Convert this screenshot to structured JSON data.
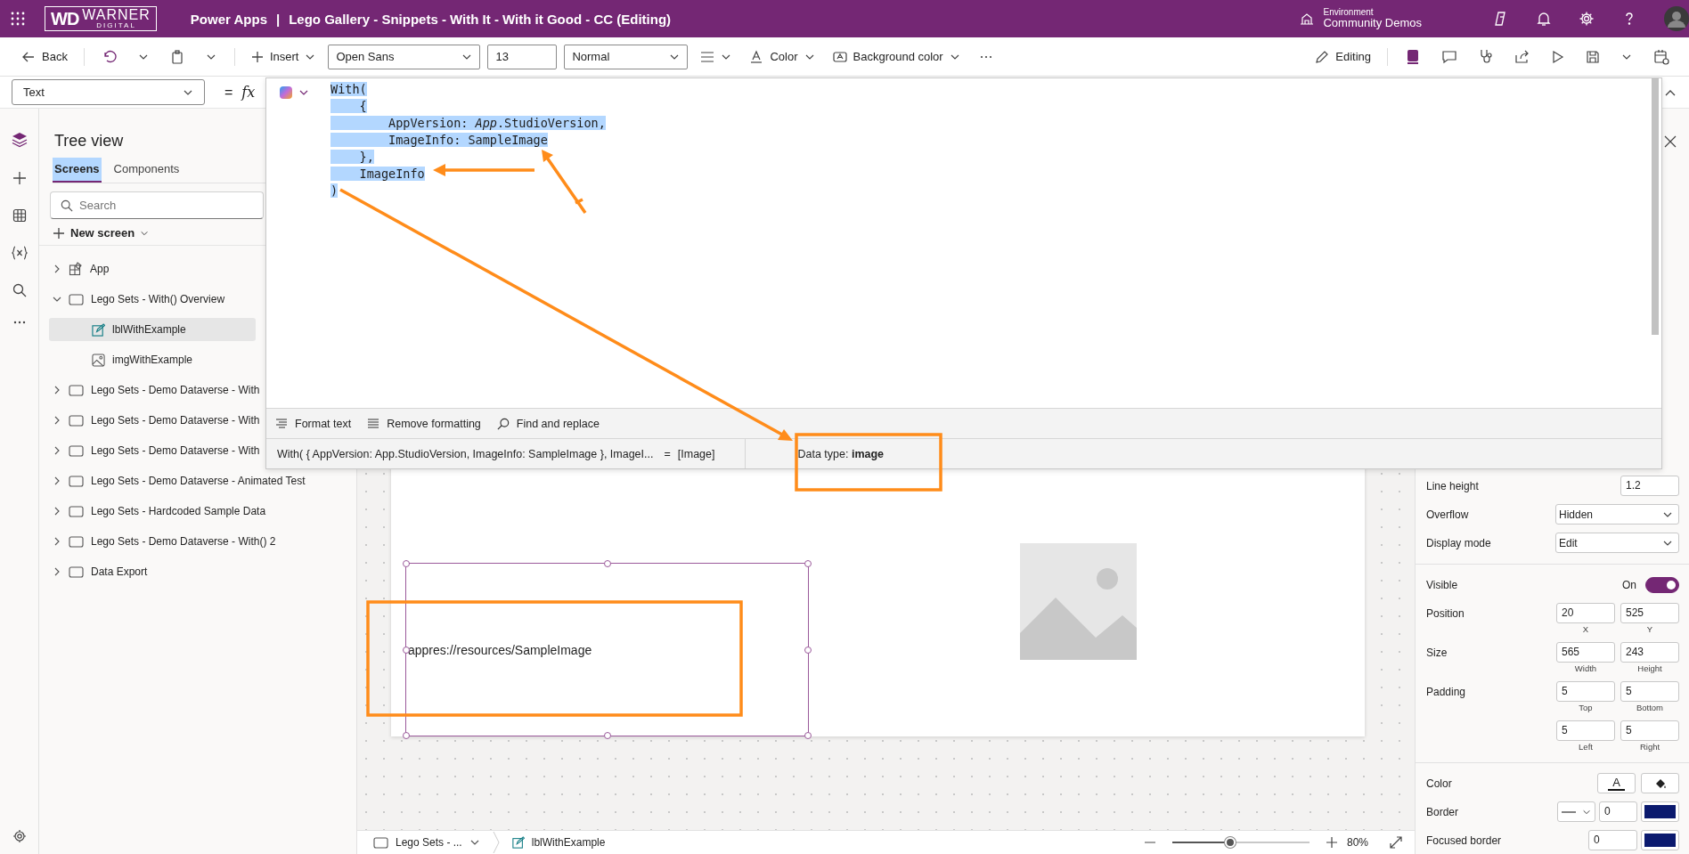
{
  "top_bar": {
    "logo": {
      "mark": "WD",
      "name": "WARNER",
      "sub": "DIGITAL"
    },
    "app_name": "Power Apps",
    "separator": "|",
    "title": "Lego Gallery - Snippets - With It - With it Good - CC (Editing)",
    "environment_label": "Environment",
    "environment": "Community Demos"
  },
  "toolbar": {
    "back": "Back",
    "insert": "Insert",
    "font": "Open Sans",
    "font_size": "13",
    "font_weight": "Normal",
    "color_label": "Color",
    "background_color": "Background color",
    "editing": "Editing"
  },
  "formula_bar": {
    "property": "Text",
    "equals": "=",
    "fx": "fx"
  },
  "formula_editor": {
    "code_lines": [
      "With(",
      "    {",
      "        AppVersion: *App*.StudioVersion,",
      "        ImageInfo: SampleImage",
      "    },",
      "    ImageInfo",
      ")"
    ],
    "tools": [
      {
        "kind": "format",
        "label": "Format text"
      },
      {
        "kind": "remove",
        "label": "Remove formatting"
      },
      {
        "kind": "find",
        "label": "Find and replace"
      }
    ],
    "result_expression": "With( { AppVersion: App.StudioVersion, ImageInfo: SampleImage }, ImageI...",
    "result_equals": "=",
    "result_value": "[Image]",
    "data_type": "Data type: **image**"
  },
  "tree": {
    "title": "Tree view",
    "tabs": [
      {
        "label": "Screens",
        "selected": true
      },
      {
        "label": "Components",
        "selected": false
      }
    ],
    "search": {
      "placeholder": "Search"
    },
    "new_screen": "New screen",
    "items": [
      {
        "kind": "app",
        "label": "App",
        "expanded": false
      },
      {
        "kind": "screen",
        "label": "Lego Sets - With() Overview",
        "expanded": true,
        "children": [
          {
            "kind": "label",
            "label": "lblWithExample",
            "selected": true
          },
          {
            "kind": "image",
            "label": "imgWithExample",
            "selected": false
          }
        ]
      },
      {
        "kind": "screen",
        "label": "Lego Sets - Demo Dataverse - With",
        "expanded": false
      },
      {
        "kind": "screen",
        "label": "Lego Sets - Demo Dataverse - With",
        "expanded": false
      },
      {
        "kind": "screen",
        "label": "Lego Sets - Demo Dataverse - With",
        "expanded": false
      },
      {
        "kind": "screen",
        "label": "Lego Sets - Demo Dataverse - Animated Test",
        "expanded": false
      },
      {
        "kind": "screen",
        "label": "Lego Sets - Hardcoded Sample Data",
        "expanded": false
      },
      {
        "kind": "screen",
        "label": "Lego Sets - Demo Dataverse - With() 2",
        "expanded": false
      },
      {
        "kind": "screen",
        "label": "Data Export",
        "expanded": false
      }
    ]
  },
  "canvas": {
    "label_control": {
      "text": "appres://resources/SampleImage",
      "selected": true
    }
  },
  "bottom_bar": {
    "screen": "Lego Sets - ...",
    "control": "lblWithExample",
    "zoom": {
      "level": 0.42,
      "reading": "80%"
    }
  },
  "property_groups": [
    {
      "rows": [
        {
          "kind": "number",
          "label": "Line height",
          "value": "1.2"
        },
        {
          "kind": "dropdown",
          "label": "Overflow",
          "value": "Hidden"
        },
        {
          "kind": "dropdown",
          "label": "Display mode",
          "value": "Edit"
        }
      ]
    },
    {
      "rows": [
        {
          "kind": "toggle",
          "label": "Visible",
          "state_label": "On",
          "on": true
        },
        {
          "kind": "pair",
          "label": "Position",
          "fields": [
            {
              "value": "20",
              "caption": "X"
            },
            {
              "value": "525",
              "caption": "Y"
            }
          ]
        },
        {
          "kind": "pair",
          "label": "Size",
          "fields": [
            {
              "value": "565",
              "caption": "Width"
            },
            {
              "value": "243",
              "caption": "Height"
            }
          ]
        },
        {
          "kind": "pair",
          "label": "Padding",
          "fields": [
            {
              "value": "5",
              "caption": "Top"
            },
            {
              "value": "5",
              "caption": "Bottom"
            }
          ]
        },
        {
          "kind": "pair",
          "fields": [
            {
              "value": "5",
              "caption": "Left"
            },
            {
              "value": "5",
              "caption": "Right"
            }
          ]
        }
      ]
    },
    {
      "rows": [
        {
          "kind": "color",
          "label": "Color",
          "glyph": "A"
        },
        {
          "kind": "border",
          "label": "Border",
          "value": "0",
          "color": "#0b1a6e"
        },
        {
          "kind": "border_plain",
          "label": "Focused border",
          "value": "0",
          "color": "#0b1a6e"
        }
      ]
    }
  ]
}
